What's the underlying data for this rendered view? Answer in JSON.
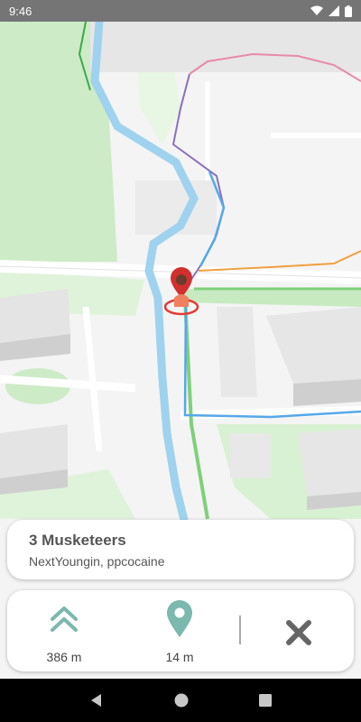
{
  "status_bar": {
    "time": "9:46",
    "icons": [
      "wifi-icon",
      "signal-icon",
      "battery-icon"
    ]
  },
  "map": {
    "marker_icon": "user-location-marker-icon"
  },
  "song": {
    "title": "3 Musketeers",
    "artists": "NextYoungin, ppcocaine"
  },
  "navigation": {
    "next_distance": "386 m",
    "next_icon": "double-chevron-up-icon",
    "poi_distance": "14 m",
    "poi_icon": "map-pin-icon",
    "close_icon": "close-icon"
  },
  "colors": {
    "accent_teal": "#7bb8ad",
    "close_gray": "#666666",
    "water_blue": "#9fd2ee",
    "park_green": "#cfecc8"
  },
  "system_nav": [
    "back-icon",
    "home-icon",
    "recents-icon"
  ]
}
